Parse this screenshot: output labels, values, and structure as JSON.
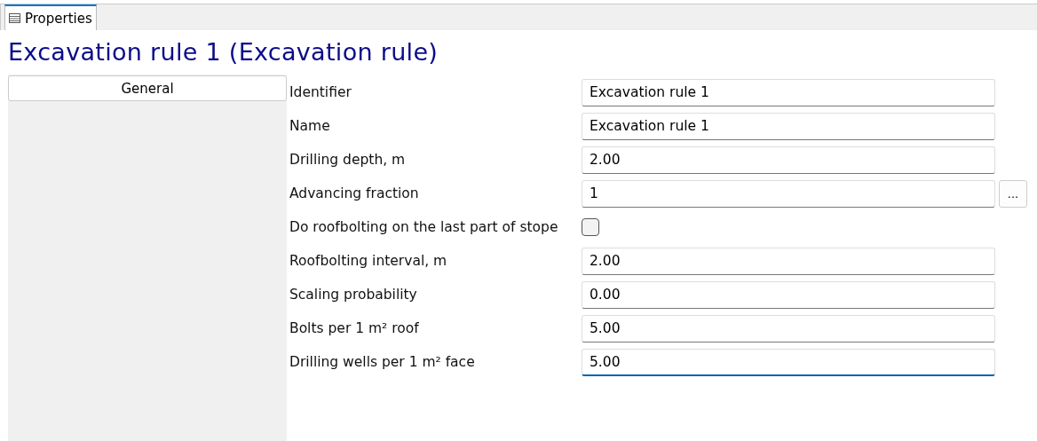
{
  "tab": {
    "label": "Properties",
    "selected": true
  },
  "title": "Excavation rule 1 (Excavation rule)",
  "sidebar": {
    "items": [
      {
        "label": "General",
        "selected": true
      }
    ]
  },
  "properties": [
    {
      "kind": "text",
      "label": "Identifier",
      "value": "Excavation rule 1",
      "focused": false
    },
    {
      "kind": "text",
      "label": "Name",
      "value": "Excavation rule 1",
      "focused": false
    },
    {
      "kind": "text",
      "label": "Drilling depth, m",
      "value": "2.00",
      "focused": false
    },
    {
      "kind": "text",
      "label": "Advancing fraction",
      "value": "1",
      "focused": false,
      "button": "..."
    },
    {
      "kind": "checkbox",
      "label": "Do roofbolting on the last part of stope",
      "checked": false
    },
    {
      "kind": "text",
      "label": "Roofbolting interval, m",
      "value": "2.00",
      "focused": false
    },
    {
      "kind": "text",
      "label": "Scaling probability",
      "value": "0.00",
      "focused": false
    },
    {
      "kind": "text",
      "label": "Bolts per 1 m² roof",
      "value": "5.00",
      "focused": false
    },
    {
      "kind": "text",
      "label": "Drilling wells per 1 m² face",
      "value": "5.00",
      "focused": true
    }
  ]
}
